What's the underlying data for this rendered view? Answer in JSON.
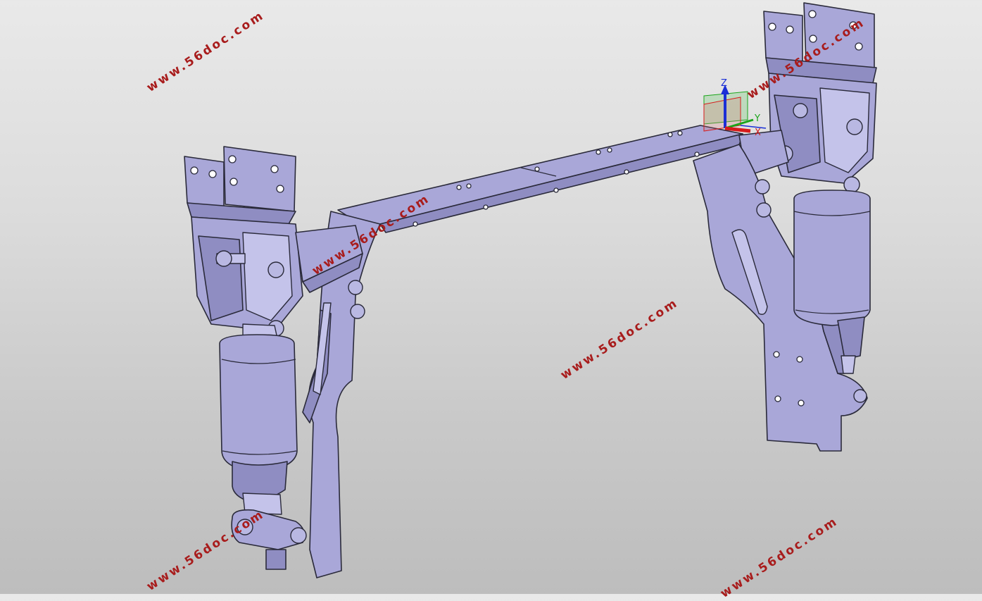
{
  "watermarks": [
    "www.56doc.com",
    "www.56doc.com",
    "www.56doc.com",
    "www.56doc.com",
    "www.56doc.com",
    "www.56doc.com"
  ],
  "triad": {
    "z_label": "Z",
    "y_label": "Y",
    "x_label": "X",
    "colors": {
      "z": "#1b2fd6",
      "y": "#1aa51a",
      "x": "#d61b1b"
    }
  },
  "colors": {
    "part": "#a9a7d8",
    "watermark": "#a81c1c",
    "background_top": "#e9e9e9",
    "background_bottom": "#bdbdbd"
  }
}
